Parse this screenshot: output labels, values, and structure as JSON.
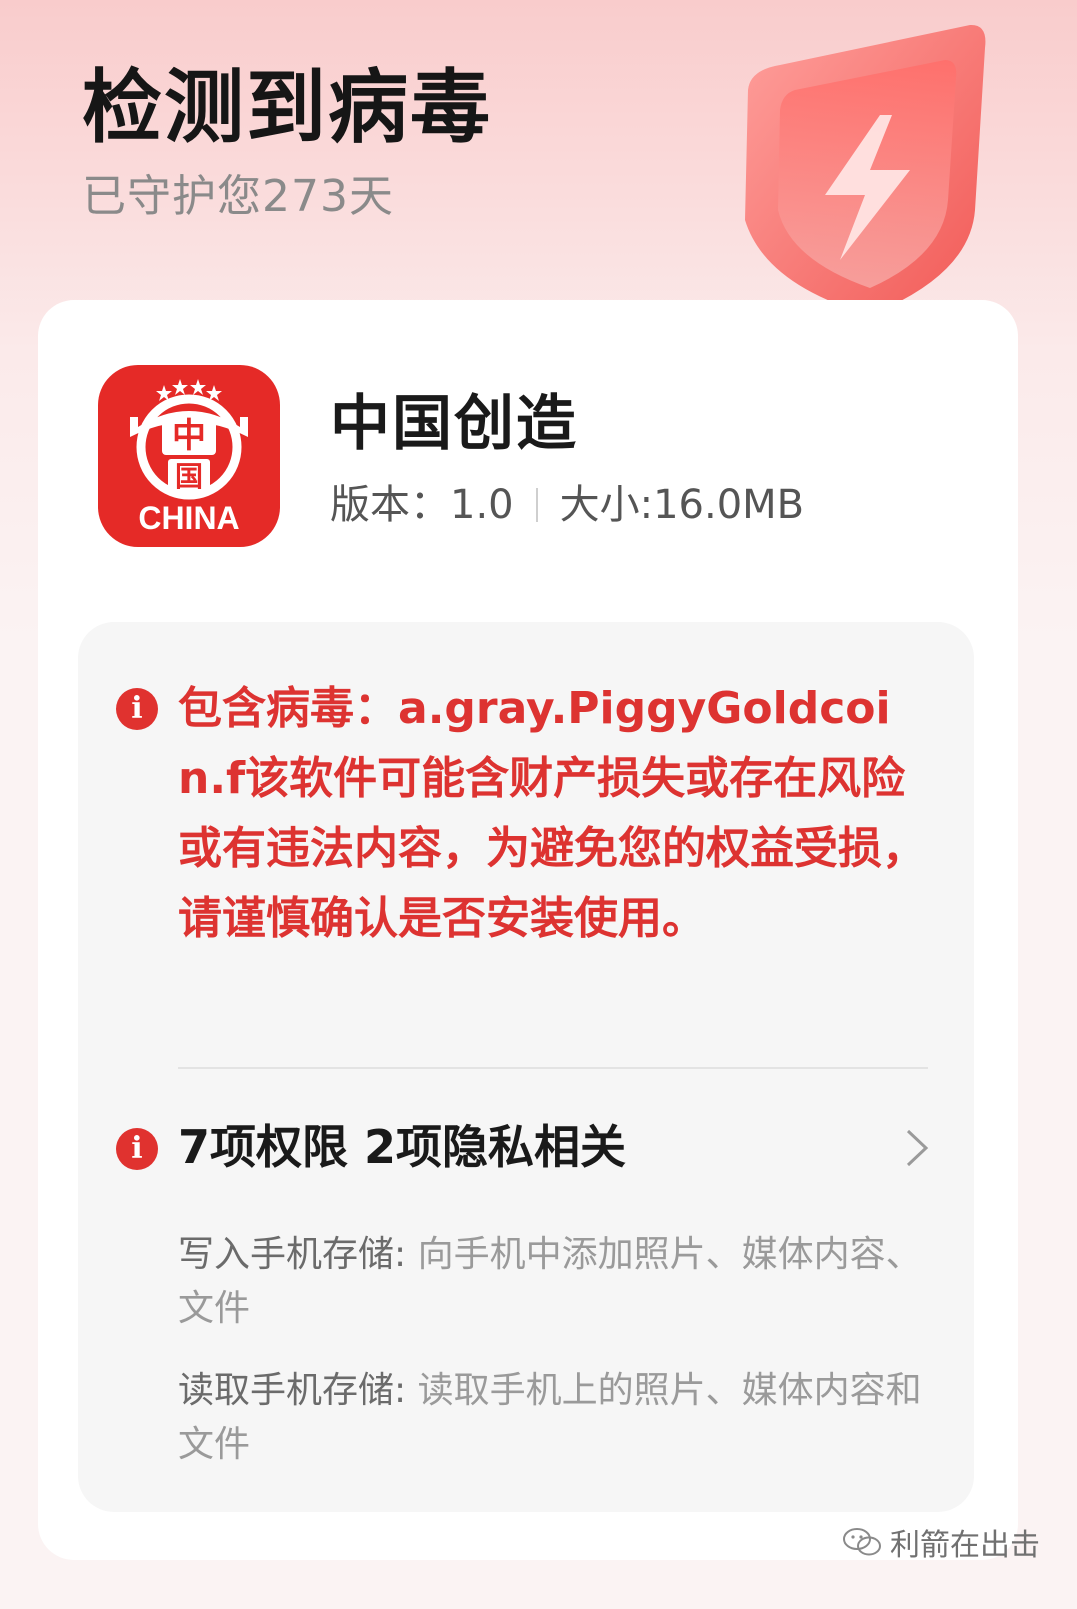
{
  "header": {
    "title": "检测到病毒",
    "subtitle": "已守护您273天"
  },
  "app": {
    "name": "中国创造",
    "version": "版本：1.0",
    "size": "大小:16.0MB",
    "icon_text": "CHINA",
    "icon_glyphs": [
      "中",
      "国"
    ]
  },
  "virus": {
    "text": "包含病毒：a.gray.PiggyGoldcoin.f该软件可能含财产损失或存在风险或有违法内容，为避免您的权益受损，请谨慎确认是否安装使用。"
  },
  "permissions": {
    "title": "7项权限 2项隐私相关",
    "items": [
      {
        "key": "写入手机存储:",
        "desc": "向手机中添加照片、媒体内容、文件"
      },
      {
        "key": "读取手机存储:",
        "desc": "读取手机上的照片、媒体内容和文件"
      }
    ]
  },
  "watermark": "利箭在出击",
  "colors": {
    "warning": "#dd3331",
    "icon_bg": "#e52a27"
  }
}
